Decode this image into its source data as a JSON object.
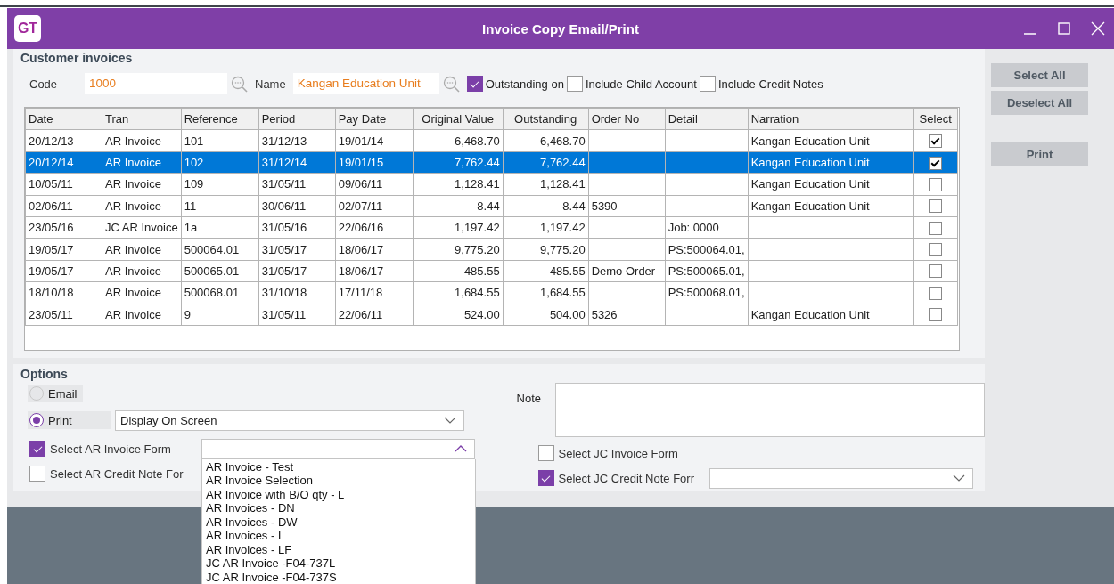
{
  "window": {
    "title": "Invoice Copy Email/Print",
    "logo": "GT"
  },
  "customer_invoices": {
    "title": "Customer invoices",
    "code": {
      "label": "Code",
      "value": "1000"
    },
    "name": {
      "label": "Name",
      "value": "Kangan Education Unit"
    },
    "filters": [
      {
        "label": "Outstanding on",
        "checked": true
      },
      {
        "label": "Include Child Account",
        "checked": false
      },
      {
        "label": "Include Credit Notes",
        "checked": false
      }
    ]
  },
  "table": {
    "columns": [
      "Date",
      "Tran",
      "Reference",
      "Period",
      "Pay Date",
      "Original Value",
      "Outstanding",
      "Order No",
      "Detail",
      "Narration",
      "Select"
    ],
    "rows": [
      {
        "date": "20/12/13",
        "tran": "AR Invoice",
        "reference": "101",
        "period": "31/12/13",
        "pay_date": "19/01/14",
        "original_value": "6,468.70",
        "outstanding": "6,468.70",
        "narration": "Kangan Education Unit",
        "checked": true,
        "selected": false
      },
      {
        "date": "20/12/14",
        "tran": "AR Invoice",
        "reference": "102",
        "period": "31/12/14",
        "pay_date": "19/01/15",
        "original_value": "7,762.44",
        "outstanding": "7,762.44",
        "narration": "Kangan Education Unit",
        "checked": true,
        "selected": true
      },
      {
        "date": "10/05/11",
        "tran": "AR Invoice",
        "reference": "109",
        "period": "31/05/11",
        "pay_date": "09/06/11",
        "original_value": "1,128.41",
        "outstanding": "1,128.41",
        "narration": "Kangan Education Unit",
        "checked": false,
        "selected": false
      },
      {
        "date": "02/06/11",
        "tran": "AR Invoice",
        "reference": "11",
        "period": "30/06/11",
        "pay_date": "02/07/11",
        "original_value": "8.44",
        "outstanding": "8.44",
        "order_no": "5390",
        "narration": "Kangan Education Unit",
        "checked": false,
        "selected": false
      },
      {
        "date": "23/05/16",
        "tran": "JC AR Invoice",
        "reference": "1a",
        "period": "31/05/16",
        "pay_date": "22/06/16",
        "original_value": "1,197.42",
        "outstanding": "1,197.42",
        "detail": "Job: 0000",
        "checked": false,
        "selected": false
      },
      {
        "date": "19/05/17",
        "tran": "AR Invoice",
        "reference": "500064.01",
        "period": "31/05/17",
        "pay_date": "18/06/17",
        "original_value": "9,775.20",
        "outstanding": "9,775.20",
        "detail": "PS:500064.01,",
        "checked": false,
        "selected": false
      },
      {
        "date": "19/05/17",
        "tran": "AR Invoice",
        "reference": "500065.01",
        "period": "31/05/17",
        "pay_date": "18/06/17",
        "original_value": "485.55",
        "outstanding": "485.55",
        "order_no": "Demo Order",
        "detail": "PS:500065.01,",
        "checked": false,
        "selected": false
      },
      {
        "date": "18/10/18",
        "tran": "AR Invoice",
        "reference": "500068.01",
        "period": "31/10/18",
        "pay_date": "17/11/18",
        "original_value": "1,684.55",
        "outstanding": "1,684.55",
        "detail": "PS:500068.01,",
        "checked": false,
        "selected": false
      },
      {
        "date": "23/05/11",
        "tran": "AR Invoice",
        "reference": "9",
        "period": "31/05/11",
        "pay_date": "22/06/11",
        "original_value": "524.00",
        "outstanding": "504.00",
        "order_no": "5326",
        "narration": "Kangan Education Unit",
        "checked": false,
        "selected": false
      }
    ]
  },
  "options": {
    "title": "Options",
    "delivery": [
      {
        "label": "Email",
        "selected": false
      },
      {
        "label": "Print",
        "selected": true,
        "value": "Display On Screen"
      }
    ],
    "note": {
      "label": "Note"
    },
    "forms_left": [
      {
        "label": "Select AR Invoice Form",
        "checked": true,
        "dropdown": {
          "expanded": true,
          "options": [
            "AR Invoice - Test",
            "AR Invoice Selection",
            "AR Invoice with B/O qty - L",
            "AR Invoices - DN",
            "AR Invoices - DW",
            "AR Invoices - L",
            "AR Invoices - LF",
            "JC AR Invoice -F04-737L",
            "JC AR Invoice -F04-737S"
          ]
        }
      },
      {
        "label": "Select AR Credit Note For",
        "checked": false
      }
    ],
    "forms_right": [
      {
        "label": "Select JC Invoice Form",
        "checked": false
      },
      {
        "label": "Select JC Credit Note Forr",
        "checked": true,
        "dropdown": {
          "expanded": false
        }
      }
    ]
  },
  "buttons": [
    {
      "label": "Select All",
      "kind": "select"
    },
    {
      "label": "Deselect All",
      "kind": "select"
    },
    {
      "label": "Print",
      "kind": "action"
    }
  ]
}
